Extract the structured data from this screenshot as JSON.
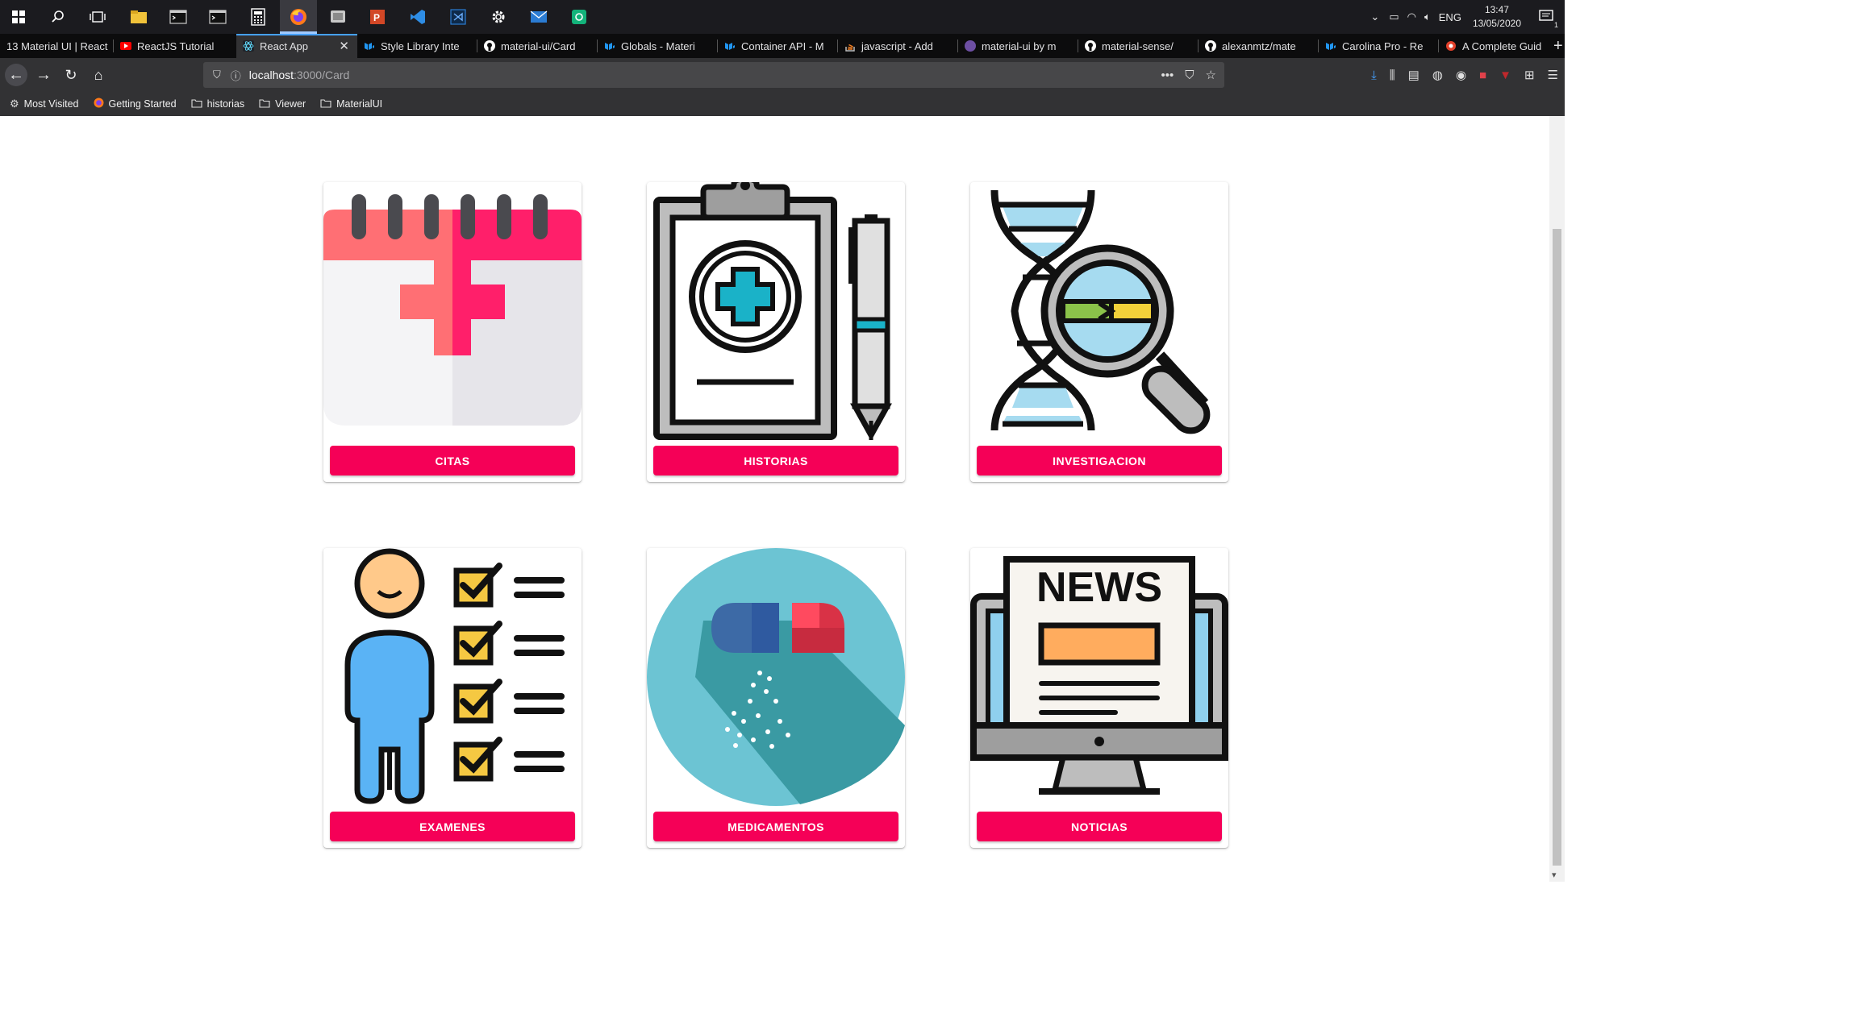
{
  "taskbar": {
    "icons": [
      "windows-start-icon",
      "search-icon",
      "task-view-icon",
      "file-explorer-icon",
      "terminal-icon",
      "terminal-icon",
      "calculator-icon",
      "firefox-icon",
      "chromium-icon",
      "powerpoint-icon",
      "vscode-icon",
      "vs-icon",
      "settings-icon",
      "mail-icon",
      "app-icon"
    ],
    "lang": "ENG",
    "time": "13:47",
    "date": "13/05/2020",
    "notifications_count": "1"
  },
  "tabs": [
    {
      "title": "13 Material UI | React",
      "favicon": "reddot"
    },
    {
      "title": "ReactJS Tutorial",
      "favicon": "youtube"
    },
    {
      "title": "React App",
      "favicon": "react",
      "active": true
    },
    {
      "title": "Style Library Inte",
      "favicon": "mui"
    },
    {
      "title": "material-ui/Card",
      "favicon": "github"
    },
    {
      "title": "Globals - Materi",
      "favicon": "mui"
    },
    {
      "title": "Container API - M",
      "favicon": "mui"
    },
    {
      "title": "javascript - Add",
      "favicon": "stackoverflow"
    },
    {
      "title": "material-ui by m",
      "favicon": "purple"
    },
    {
      "title": "material-sense/",
      "favicon": "github"
    },
    {
      "title": "alexanmtz/mate",
      "favicon": "github"
    },
    {
      "title": "Carolina Pro - Re",
      "favicon": "mui"
    },
    {
      "title": "A Complete Guid",
      "favicon": "red"
    }
  ],
  "url": {
    "host": "localhost",
    "path": ":3000/Card"
  },
  "bookmarks": [
    {
      "label": "Most Visited",
      "icon": "gear-icon"
    },
    {
      "label": "Getting Started",
      "icon": "firefox-icon"
    },
    {
      "label": "historias",
      "icon": "folder-icon"
    },
    {
      "label": "Viewer",
      "icon": "folder-icon"
    },
    {
      "label": "MaterialUI",
      "icon": "folder-icon"
    }
  ],
  "cards": [
    {
      "label": "CITAS",
      "icon": "calendar-medical-icon"
    },
    {
      "label": "HISTORIAS",
      "icon": "clipboard-medical-icon"
    },
    {
      "label": "INVESTIGACION",
      "icon": "dna-magnifier-icon"
    },
    {
      "label": "EXAMENES",
      "icon": "checklist-person-icon"
    },
    {
      "label": "MEDICAMENTOS",
      "icon": "pill-icon"
    },
    {
      "label": "NOTICIAS",
      "icon": "news-monitor-icon"
    }
  ],
  "colors": {
    "accent": "#f50057",
    "tab_active_line": "#45a1ff"
  }
}
